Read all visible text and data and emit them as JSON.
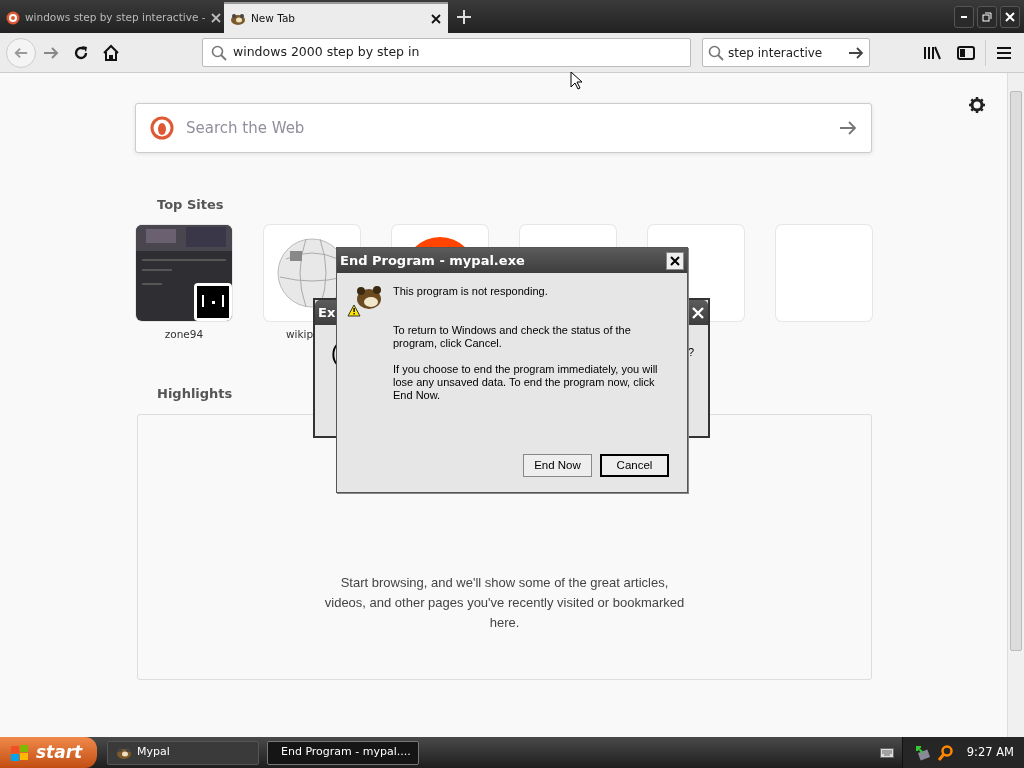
{
  "browser": {
    "tabs": [
      {
        "title": "windows step by step interactive -",
        "selected": false,
        "kind": "search"
      },
      {
        "title": "New Tab",
        "selected": true,
        "kind": "mascot"
      }
    ],
    "address": {
      "value": "windows 2000 step by step in"
    },
    "search": {
      "value": "step interactive"
    }
  },
  "new_tab": {
    "search": {
      "placeholder": "Search the Web"
    },
    "top_sites_heading": "Top Sites",
    "top_sites": [
      {
        "label": "zone94",
        "kind": "screenshot"
      },
      {
        "label": "wikip",
        "kind": "wikipedia"
      },
      {
        "kind": "orange"
      },
      {
        "kind": "empty"
      },
      {
        "kind": "empty"
      },
      {
        "kind": "empty"
      }
    ],
    "highlights_heading": "Highlights",
    "highlights_message": "Start browsing, and we'll show some of the great articles, videos, and other pages you've recently visited or bookmarked here."
  },
  "back_dialog": {
    "title": "Ex",
    "fragment_left": "(",
    "fragment_right": "?"
  },
  "dialog": {
    "title": "End Program - mypal.exe",
    "paragraphs": [
      "This program is not responding.",
      "To return to Windows and check the status of the program, click Cancel.",
      "If you choose to end the program immediately, you will lose any unsaved data. To end the program now, click End Now."
    ],
    "buttons": [
      {
        "label": "End Now",
        "default": false
      },
      {
        "label": "Cancel",
        "default": true
      }
    ]
  },
  "taskbar": {
    "start": "start",
    "tasks": [
      {
        "label": "Mypal",
        "selected": false,
        "kind": "mascot"
      },
      {
        "label": "End Program - mypal....",
        "selected": true,
        "kind": "window"
      }
    ],
    "clock": "9:27 AM"
  }
}
